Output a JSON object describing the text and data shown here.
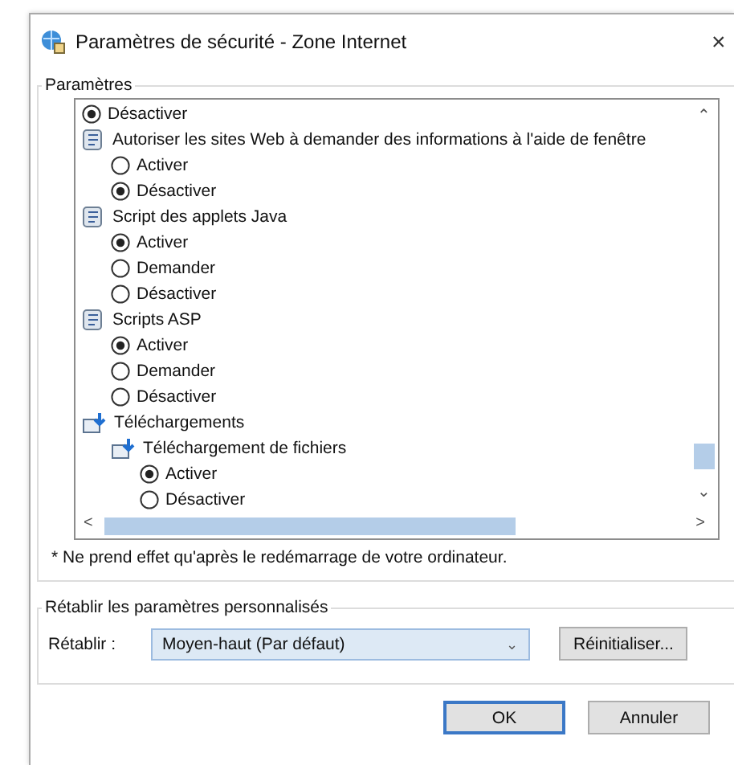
{
  "window": {
    "title": "Paramètres de sécurité - Zone Internet",
    "close": "×"
  },
  "settings_group": {
    "title": "Paramètres",
    "tree": [
      {
        "children": [
          {
            "children": [
              {
                "kind": "option",
                "label": "Désactiver",
                "selected": true
              }
            ]
          },
          {
            "kind": "setting",
            "label": "Autoriser les sites Web à demander des informations à l'aide de fenêtre",
            "children": [
              {
                "kind": "option",
                "label": "Activer",
                "selected": false
              },
              {
                "kind": "option",
                "label": "Désactiver",
                "selected": true
              }
            ]
          },
          {
            "kind": "setting",
            "label": "Script des applets Java",
            "children": [
              {
                "kind": "option",
                "label": "Activer",
                "selected": true
              },
              {
                "kind": "option",
                "label": "Demander",
                "selected": false
              },
              {
                "kind": "option",
                "label": "Désactiver",
                "selected": false
              }
            ]
          },
          {
            "kind": "setting",
            "label": "Scripts ASP",
            "children": [
              {
                "kind": "option",
                "label": "Activer",
                "selected": true
              },
              {
                "kind": "option",
                "label": "Demander",
                "selected": false
              },
              {
                "kind": "option",
                "label": "Désactiver",
                "selected": false
              }
            ]
          }
        ]
      },
      {
        "kind": "category",
        "label": "Téléchargements",
        "children": [
          {
            "kind": "download",
            "label": "Téléchargement de fichiers",
            "children": [
              {
                "kind": "option",
                "label": "Activer",
                "selected": true
              },
              {
                "kind": "option",
                "label": "Désactiver",
                "selected": false
              }
            ]
          }
        ]
      }
    ],
    "scroll_arrows": [
      "⌃",
      "⌄",
      "<",
      ">"
    ],
    "note": "* Ne prend effet qu'après le redémarrage de votre ordinateur."
  },
  "reset_group": {
    "title": "Rétablir les paramètres personnalisés",
    "label": "Rétablir :",
    "value": "Moyen-haut (Par défaut)",
    "caret": "⌄",
    "button": "Réinitialiser..."
  },
  "buttons": [
    {
      "label": "OK",
      "default": true
    },
    {
      "label": "Annuler",
      "default": false
    }
  ]
}
